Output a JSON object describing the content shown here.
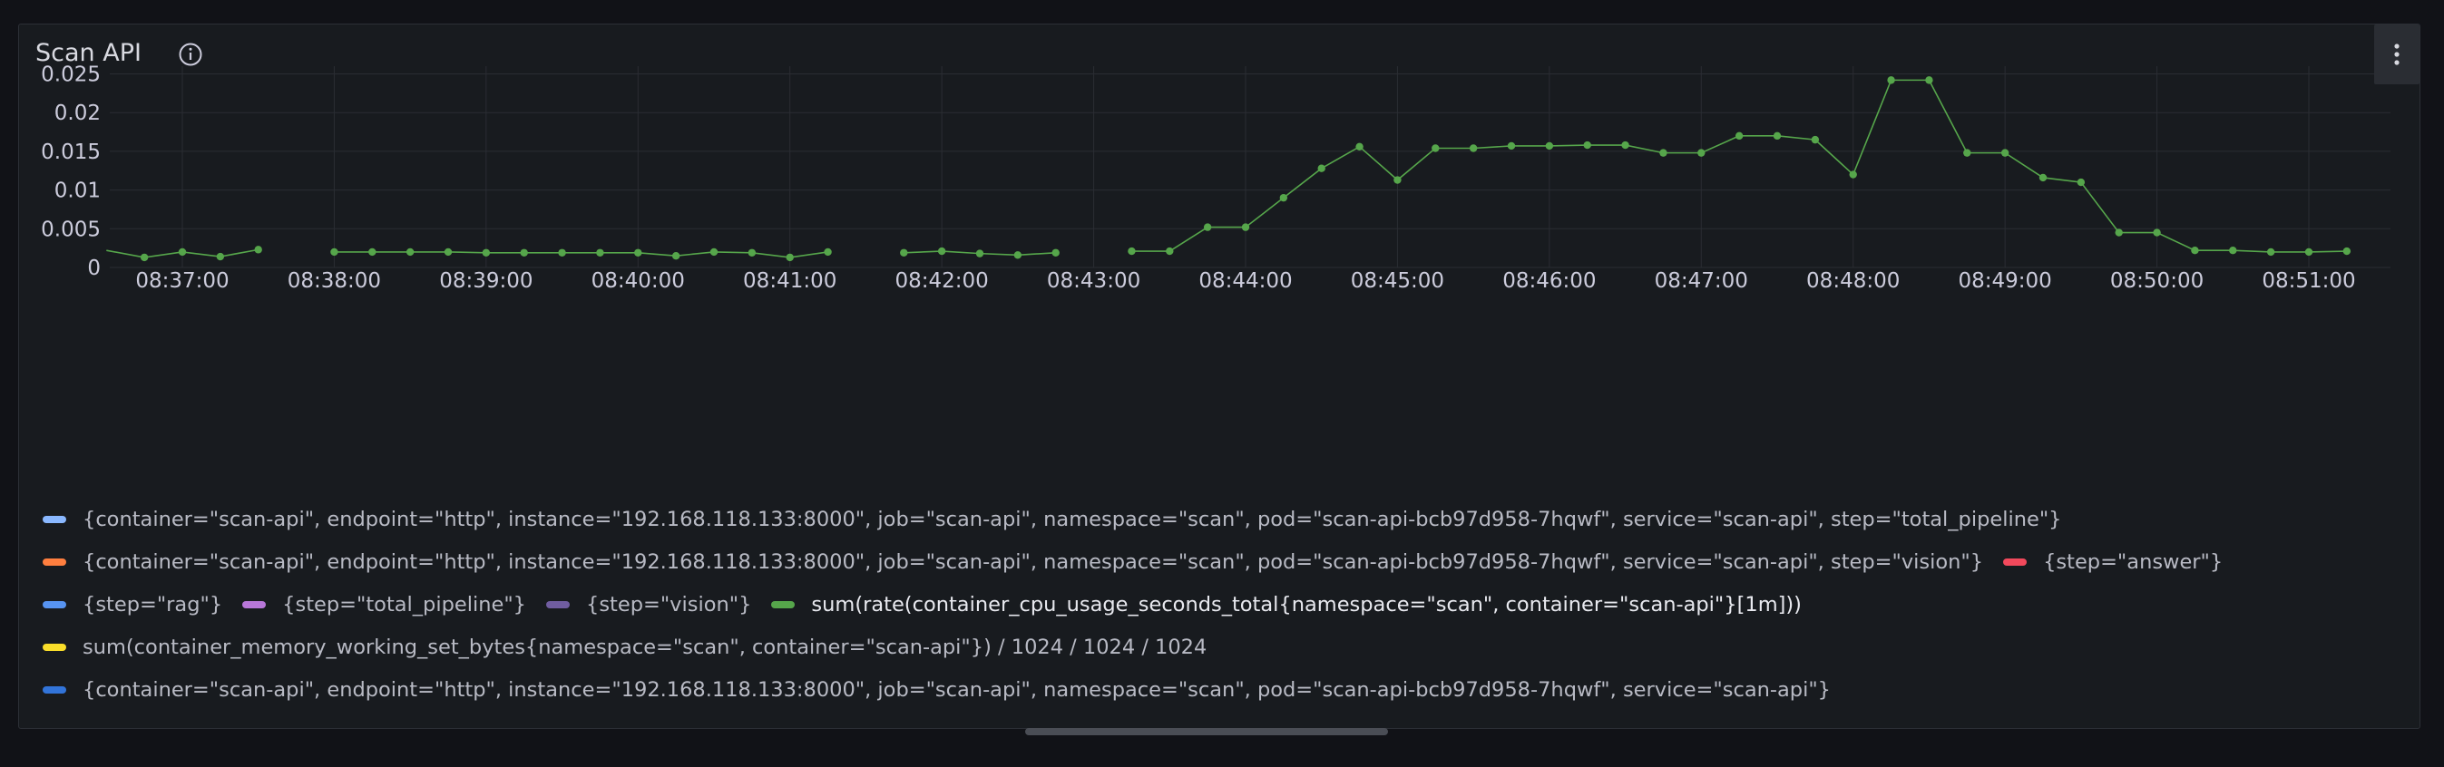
{
  "panel": {
    "title": "Scan API"
  },
  "chart_data": {
    "type": "line",
    "title": "Scan API",
    "xlabel": "",
    "ylabel": "",
    "ylim": [
      0,
      0.026
    ],
    "y_ticks": [
      "0",
      "0.005",
      "0.01",
      "0.015",
      "0.02",
      "0.025"
    ],
    "y_tick_values": [
      0,
      0.005,
      0.01,
      0.015,
      0.02,
      0.025
    ],
    "x_ticks": [
      "08:37:00",
      "08:38:00",
      "08:39:00",
      "08:40:00",
      "08:41:00",
      "08:42:00",
      "08:43:00",
      "08:44:00",
      "08:45:00",
      "08:46:00",
      "08:47:00",
      "08:48:00",
      "08:49:00",
      "08:50:00",
      "08:51:00"
    ],
    "grid": true,
    "series": [
      {
        "name": "sum(rate(container_cpu_usage_seconds_total{namespace=\"scan\", container=\"scan-api\"}[1m]))",
        "color": "#56a64b",
        "interval_seconds": 15,
        "start_time": "08:36:30",
        "values": [
          0.0022,
          0.0013,
          0.002,
          0.0014,
          0.0023,
          null,
          0.002,
          0.002,
          0.002,
          0.002,
          0.0019,
          0.0019,
          0.0019,
          0.0019,
          0.0019,
          0.0015,
          0.002,
          0.0019,
          0.0013,
          0.002,
          null,
          0.0019,
          0.0021,
          0.0018,
          0.0016,
          0.0019,
          null,
          0.0021,
          0.0021,
          0.0052,
          0.0052,
          0.009,
          0.0128,
          0.0156,
          0.0113,
          0.0154,
          0.0154,
          0.0157,
          0.0157,
          0.0158,
          0.0158,
          0.0148,
          0.0148,
          0.017,
          0.017,
          0.0165,
          0.012,
          0.0242,
          0.0242,
          0.0148,
          0.0148,
          0.0116,
          0.011,
          0.0045,
          0.0045,
          0.0022,
          0.0022,
          0.002,
          0.002,
          0.0021
        ]
      }
    ]
  },
  "legend": [
    {
      "label": "{container=\"scan-api\", endpoint=\"http\", instance=\"192.168.118.133:8000\", job=\"scan-api\", namespace=\"scan\", pod=\"scan-api-bcb97d958-7hqwf\", service=\"scan-api\", step=\"total_pipeline\"}",
      "color": "#8ab8ff",
      "row": 0,
      "active": false
    },
    {
      "label": "{container=\"scan-api\", endpoint=\"http\", instance=\"192.168.118.133:8000\", job=\"scan-api\", namespace=\"scan\", pod=\"scan-api-bcb97d958-7hqwf\", service=\"scan-api\", step=\"vision\"}",
      "color": "#ff7f3f",
      "row": 1,
      "active": false
    },
    {
      "label": "{step=\"answer\"}",
      "color": "#f2495c",
      "row": 1,
      "active": false
    },
    {
      "label": "{step=\"rag\"}",
      "color": "#5794f2",
      "row": 2,
      "active": false
    },
    {
      "label": "{step=\"total_pipeline\"}",
      "color": "#b877d9",
      "row": 2,
      "active": false
    },
    {
      "label": "{step=\"vision\"}",
      "color": "#705da0",
      "row": 2,
      "active": false
    },
    {
      "label": "sum(rate(container_cpu_usage_seconds_total{namespace=\"scan\", container=\"scan-api\"}[1m]))",
      "color": "#56a64b",
      "row": 2,
      "active": true
    },
    {
      "label": "sum(container_memory_working_set_bytes{namespace=\"scan\", container=\"scan-api\"}) / 1024 / 1024 / 1024",
      "color": "#fade2a",
      "row": 3,
      "active": false
    },
    {
      "label": "{container=\"scan-api\", endpoint=\"http\", instance=\"192.168.118.133:8000\", job=\"scan-api\", namespace=\"scan\", pod=\"scan-api-bcb97d958-7hqwf\", service=\"scan-api\"}",
      "color": "#3274d9",
      "row": 4,
      "active": false
    }
  ]
}
